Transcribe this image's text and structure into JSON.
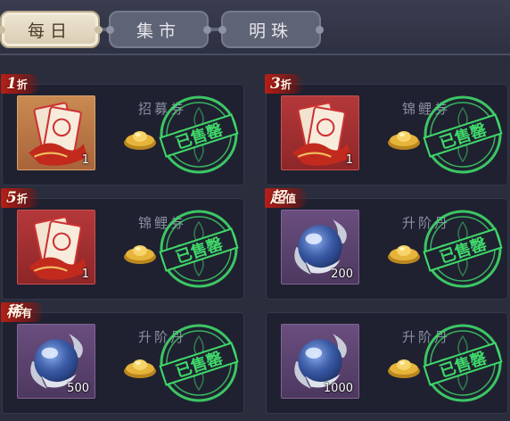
{
  "tabs": [
    {
      "label": "每日",
      "active": true
    },
    {
      "label": "集市",
      "active": false
    },
    {
      "label": "明珠",
      "active": false
    }
  ],
  "sold_stamp_text": "已售罄",
  "cards": [
    {
      "badge": "1",
      "badge_suffix": "折",
      "item_name": "招募券",
      "qty": "1",
      "icon": "recruit-ticket-icon",
      "box_color": "gold"
    },
    {
      "badge": "3",
      "badge_suffix": "折",
      "item_name": "锦鲤券",
      "qty": "1",
      "icon": "koi-ticket-icon",
      "box_color": "red"
    },
    {
      "badge": "5",
      "badge_suffix": "折",
      "item_name": "锦鲤券",
      "qty": "1",
      "icon": "koi-ticket-icon",
      "box_color": "red"
    },
    {
      "badge": "超",
      "badge_suffix": "值",
      "item_name": "升阶丹",
      "qty": "200",
      "icon": "blue-orb-icon",
      "box_color": "purple"
    },
    {
      "badge": "稀",
      "badge_suffix": "有",
      "item_name": "升阶丹",
      "qty": "500",
      "icon": "blue-orb-icon",
      "box_color": "purple"
    },
    {
      "badge": "",
      "badge_suffix": "",
      "item_name": "升阶丹",
      "qty": "1000",
      "icon": "blue-orb-icon",
      "box_color": "purple"
    }
  ],
  "colors": {
    "stamp_green": "#3fd86a",
    "badge_red": "#be1e14"
  }
}
